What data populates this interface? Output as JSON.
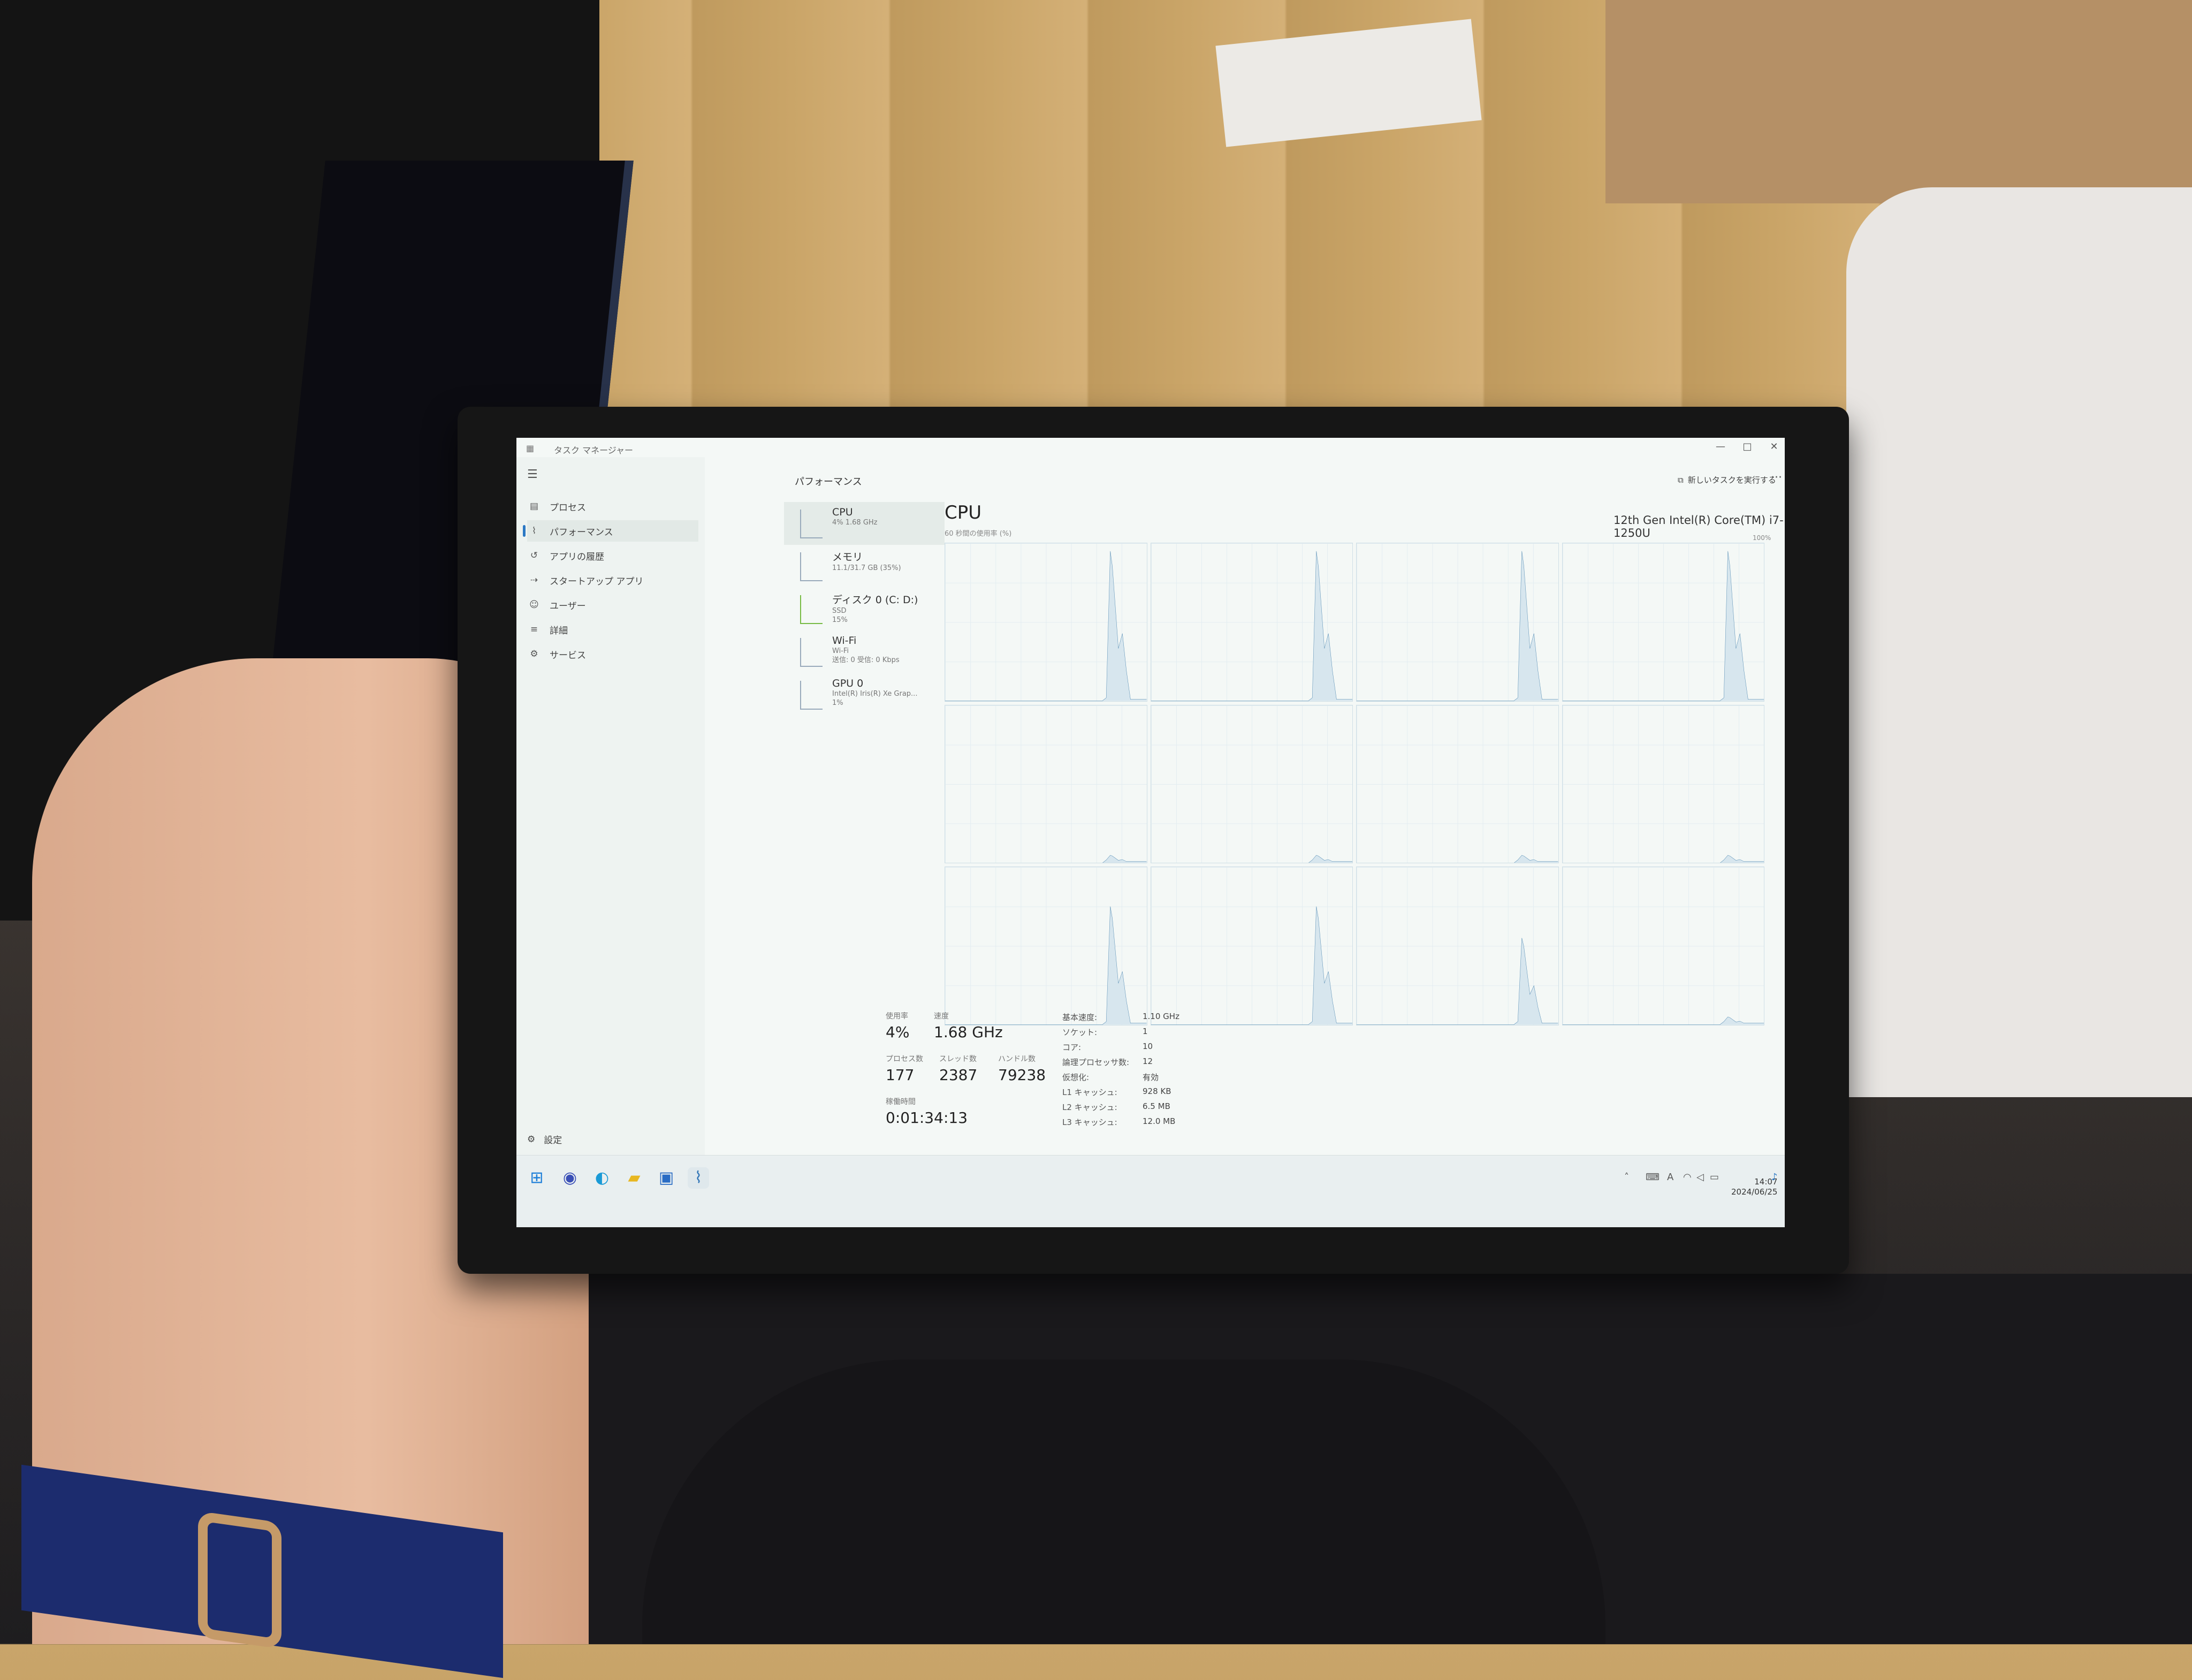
{
  "window": {
    "title": "タスク マネージャー",
    "minimize": "—",
    "maximize": "□",
    "close": "✕"
  },
  "nav": {
    "items": [
      {
        "label": "プロセス",
        "icon": "processes-icon"
      },
      {
        "label": "パフォーマンス",
        "icon": "performance-icon",
        "active": true
      },
      {
        "label": "アプリの履歴",
        "icon": "app-history-icon"
      },
      {
        "label": "スタートアップ アプリ",
        "icon": "startup-apps-icon"
      },
      {
        "label": "ユーザー",
        "icon": "users-icon"
      },
      {
        "label": "詳細",
        "icon": "details-icon"
      },
      {
        "label": "サービス",
        "icon": "services-icon"
      }
    ],
    "settings_label": "設定"
  },
  "header": {
    "title": "パフォーマンス",
    "run_task": "新しいタスクを実行する",
    "more": "···"
  },
  "resources": [
    {
      "name": "CPU",
      "line1": "4% 1.68 GHz",
      "line2": ""
    },
    {
      "name": "メモリ",
      "line1": "11.1/31.7 GB (35%)",
      "line2": ""
    },
    {
      "name": "ディスク 0 (C: D:)",
      "line1": "SSD",
      "line2": "15%"
    },
    {
      "name": "Wi-Fi",
      "line1": "Wi-Fi",
      "line2": "送信: 0 受信: 0 Kbps"
    },
    {
      "name": "GPU 0",
      "line1": "Intel(R) Iris(R) Xe Grap...",
      "line2": "1%"
    }
  ],
  "cpu": {
    "title": "CPU",
    "subtitle": "60 秒間の使用率 (%)",
    "model": "12th Gen Intel(R) Core(TM) i7-1250U",
    "max_label": "100%",
    "core_usage_peaks_pct": [
      95,
      95,
      95,
      95,
      5,
      5,
      5,
      5,
      75,
      75,
      55,
      5
    ]
  },
  "stats": {
    "utilization_label": "使用率",
    "utilization": "4%",
    "speed_label": "速度",
    "speed": "1.68 GHz",
    "processes_label": "プロセス数",
    "processes": "177",
    "threads_label": "スレッド数",
    "threads": "2387",
    "handles_label": "ハンドル数",
    "handles": "79238",
    "uptime_label": "稼働時間",
    "uptime": "0:01:34:13"
  },
  "info": [
    {
      "k": "基本速度:",
      "v": "1.10 GHz"
    },
    {
      "k": "ソケット:",
      "v": "1"
    },
    {
      "k": "コア:",
      "v": "10"
    },
    {
      "k": "論理プロセッサ数:",
      "v": "12"
    },
    {
      "k": "仮想化:",
      "v": "有効"
    },
    {
      "k": "L1 キャッシュ:",
      "v": "928 KB"
    },
    {
      "k": "L2 キャッシュ:",
      "v": "6.5 MB"
    },
    {
      "k": "L3 キャッシュ:",
      "v": "12.0 MB"
    }
  ],
  "taskbar": {
    "time": "14:07",
    "date": "2024/06/25"
  },
  "colors": {
    "accent": "#2b78c4",
    "graph_line": "#5f93b8",
    "graph_fill": "#d7e6ee"
  }
}
